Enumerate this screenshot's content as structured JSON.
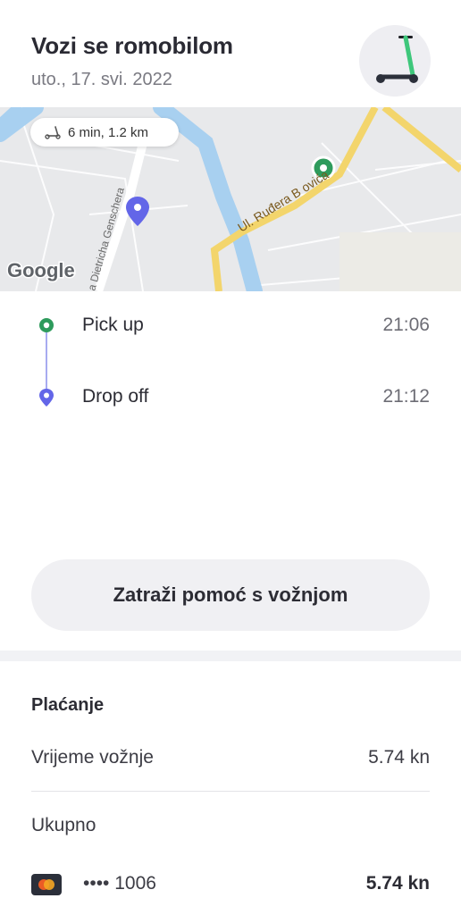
{
  "header": {
    "title": "Vozi se romobilom",
    "date": "uto., 17. svi. 2022"
  },
  "map": {
    "trip_summary": "6 min, 1.2 km",
    "street_label": "Ul. Ruđera Boškovića",
    "street_label_visible": "Ul. Ruđera B    ovića",
    "street_label_2": "a Dietricha Genschera",
    "provider": "Google",
    "colors": {
      "pickup": "#2e9b5c",
      "dropoff": "#6366e8",
      "river": "#a8d0f0",
      "road": "#f5d96a"
    }
  },
  "timeline": {
    "pickup": {
      "label": "Pick up",
      "time": "21:06",
      "icon": "green-circle-icon"
    },
    "dropoff": {
      "label": "Drop off",
      "time": "21:12",
      "icon": "purple-pin-icon"
    }
  },
  "help_button": {
    "label": "Zatraži pomoć s vožnjom"
  },
  "payment": {
    "heading": "Plaćanje",
    "fare_label": "Vrijeme vožnje",
    "fare_value": "5.74 kn",
    "total_label": "Ukupno",
    "card_number": "•••• 1006",
    "card_total": "5.74 kn",
    "card_icon": "mastercard-icon"
  }
}
